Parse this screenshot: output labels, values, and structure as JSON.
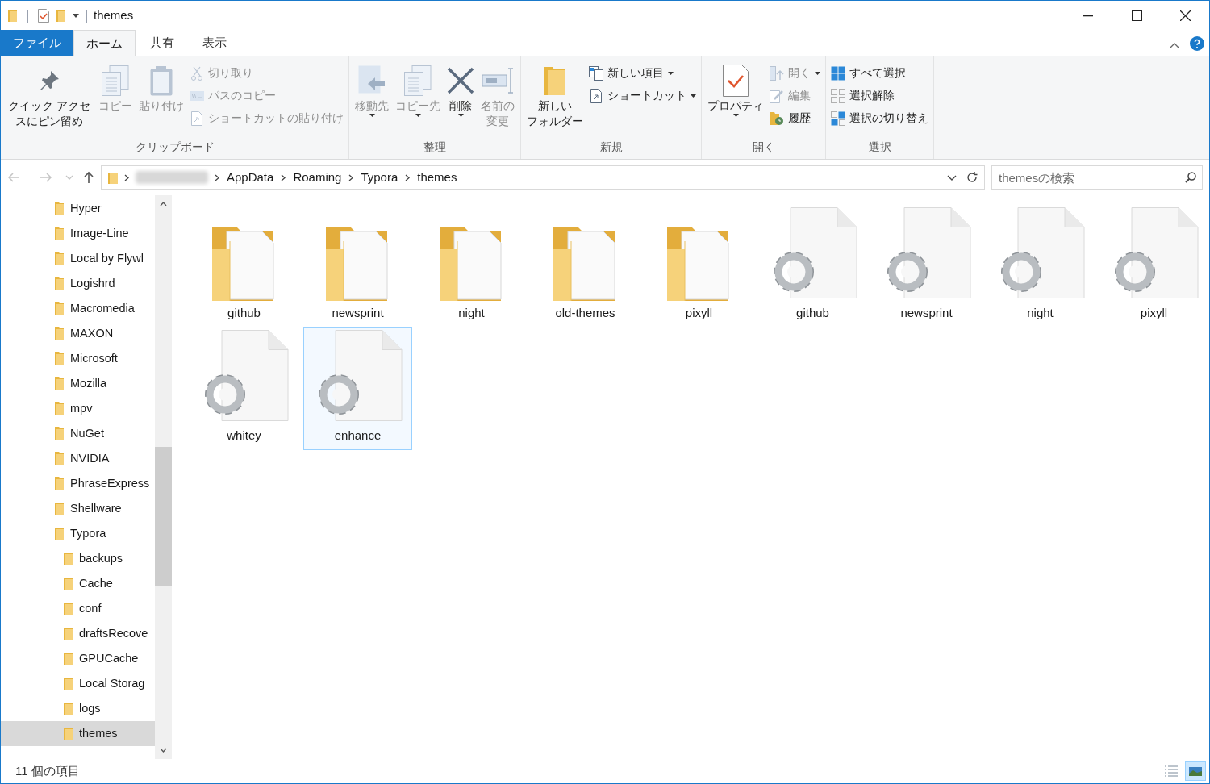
{
  "window": {
    "title": "themes"
  },
  "ribbon_tabs": [
    {
      "label": "ファイル",
      "kind": "file",
      "selected": false
    },
    {
      "label": "ホーム",
      "kind": "tab",
      "selected": true
    },
    {
      "label": "共有",
      "kind": "tab",
      "selected": false
    },
    {
      "label": "表示",
      "kind": "tab",
      "selected": false
    }
  ],
  "ribbon_groups": [
    {
      "label": "クリップボード",
      "items": [
        {
          "label": "クイック アクセスにピン留め",
          "kind": "large",
          "disabled": false,
          "menu": false
        },
        {
          "label": "コピー",
          "kind": "large",
          "disabled": true,
          "menu": false
        },
        {
          "label": "貼り付け",
          "kind": "large",
          "disabled": true,
          "menu": false
        },
        {
          "label": "切り取り",
          "kind": "small",
          "disabled": true,
          "menu": false
        },
        {
          "label": "パスのコピー",
          "kind": "small",
          "disabled": true,
          "menu": false
        },
        {
          "label": "ショートカットの貼り付け",
          "kind": "small",
          "disabled": true,
          "menu": false
        }
      ]
    },
    {
      "label": "整理",
      "items": [
        {
          "label": "移動先",
          "kind": "large",
          "disabled": true,
          "menu": true
        },
        {
          "label": "コピー先",
          "kind": "large",
          "disabled": true,
          "menu": true
        },
        {
          "label": "削除",
          "kind": "large",
          "disabled": false,
          "menu": true
        },
        {
          "label": "名前の変更",
          "kind": "large",
          "disabled": true,
          "menu": false
        }
      ]
    },
    {
      "label": "新規",
      "items": [
        {
          "label": "新しいフォルダー",
          "kind": "large",
          "disabled": false,
          "menu": false
        },
        {
          "label": "新しい項目",
          "kind": "small",
          "disabled": false,
          "menu": true
        },
        {
          "label": "ショートカット",
          "kind": "small",
          "disabled": false,
          "menu": true
        }
      ]
    },
    {
      "label": "開く",
      "items": [
        {
          "label": "プロパティ",
          "kind": "large",
          "disabled": false,
          "menu": true
        },
        {
          "label": "開く",
          "kind": "small",
          "disabled": true,
          "menu": true
        },
        {
          "label": "編集",
          "kind": "small",
          "disabled": true,
          "menu": false
        },
        {
          "label": "履歴",
          "kind": "small",
          "disabled": false,
          "menu": false
        }
      ]
    },
    {
      "label": "選択",
      "items": [
        {
          "label": "すべて選択",
          "kind": "small",
          "disabled": false,
          "menu": false
        },
        {
          "label": "選択解除",
          "kind": "small",
          "disabled": false,
          "menu": false
        },
        {
          "label": "選択の切り替え",
          "kind": "small",
          "disabled": false,
          "menu": false
        }
      ]
    }
  ],
  "address_bar": {
    "path": [
      "AppData",
      "Roaming",
      "Typora",
      "themes"
    ]
  },
  "search": {
    "placeholder": "themesの検索"
  },
  "sidebar": {
    "items": [
      {
        "label": "Hyper",
        "selected": false
      },
      {
        "label": "Image-Line",
        "selected": false
      },
      {
        "label": "Local by Flywl",
        "selected": false
      },
      {
        "label": "Logishrd",
        "selected": false
      },
      {
        "label": "Macromedia",
        "selected": false
      },
      {
        "label": "MAXON",
        "selected": false
      },
      {
        "label": "Microsoft",
        "selected": false
      },
      {
        "label": "Mozilla",
        "selected": false
      },
      {
        "label": "mpv",
        "selected": false
      },
      {
        "label": "NuGet",
        "selected": false
      },
      {
        "label": "NVIDIA",
        "selected": false
      },
      {
        "label": "PhraseExpress",
        "selected": false
      },
      {
        "label": "Shellware",
        "selected": false
      },
      {
        "label": "Typora",
        "selected": false,
        "children": [
          {
            "label": "backups",
            "selected": false
          },
          {
            "label": "Cache",
            "selected": false
          },
          {
            "label": "conf",
            "selected": false
          },
          {
            "label": "draftsRecove",
            "selected": false
          },
          {
            "label": "GPUCache",
            "selected": false
          },
          {
            "label": "Local Storag",
            "selected": false
          },
          {
            "label": "logs",
            "selected": false
          },
          {
            "label": "themes",
            "selected": true
          }
        ]
      }
    ]
  },
  "files": [
    {
      "name": "github",
      "kind": "folder",
      "selected": false
    },
    {
      "name": "newsprint",
      "kind": "folder",
      "selected": false
    },
    {
      "name": "night",
      "kind": "folder",
      "selected": false
    },
    {
      "name": "old-themes",
      "kind": "folder",
      "selected": false
    },
    {
      "name": "pixyll",
      "kind": "folder",
      "selected": false
    },
    {
      "name": "github",
      "kind": "file",
      "selected": false
    },
    {
      "name": "newsprint",
      "kind": "file",
      "selected": false
    },
    {
      "name": "night",
      "kind": "file",
      "selected": false
    },
    {
      "name": "pixyll",
      "kind": "file",
      "selected": false
    },
    {
      "name": "whitey",
      "kind": "file",
      "selected": false
    },
    {
      "name": "enhance",
      "kind": "file",
      "selected": true
    }
  ],
  "status_bar": {
    "text": "11 個の項目",
    "view_buttons": [
      {
        "selected": false
      },
      {
        "selected": true
      }
    ]
  }
}
